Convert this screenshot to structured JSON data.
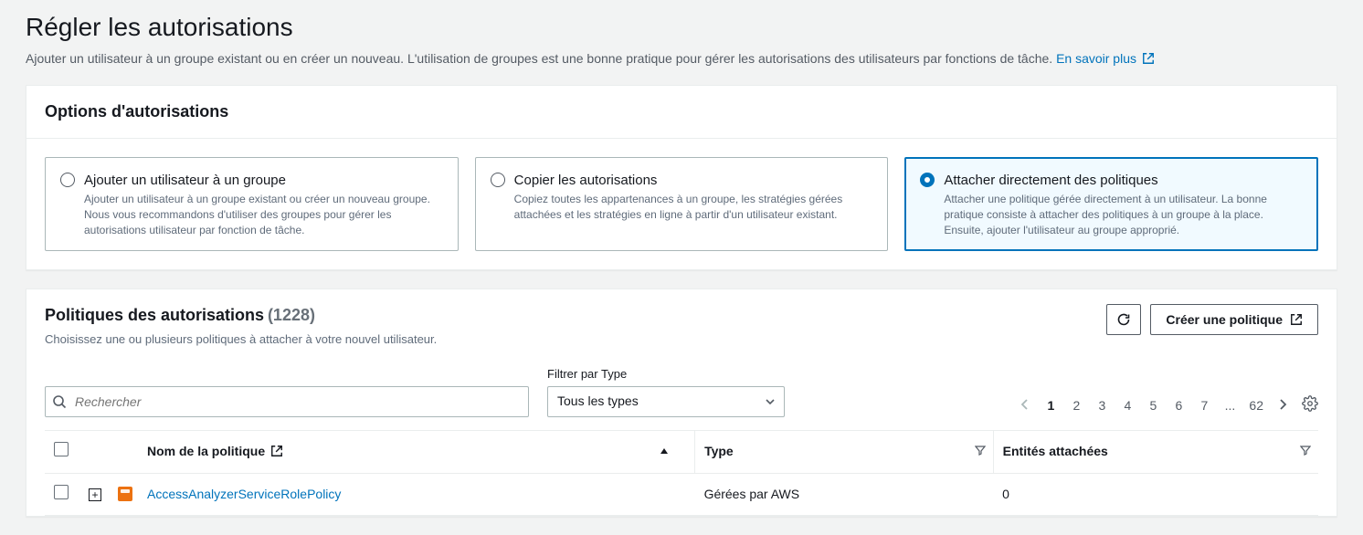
{
  "page": {
    "title": "Régler les autorisations",
    "subtitle_prefix": "Ajouter un utilisateur à un groupe existant ou en créer un nouveau. L'utilisation de groupes est une bonne pratique pour gérer les autorisations des utilisateurs par fonctions de tâche. ",
    "learn_more": "En savoir plus"
  },
  "options": {
    "panel_title": "Options d'autorisations",
    "items": [
      {
        "title": "Ajouter un utilisateur à un groupe",
        "desc": "Ajouter un utilisateur à un groupe existant ou créer un nouveau groupe. Nous vous recommandons d'utiliser des groupes pour gérer les autorisations utilisateur par fonction de tâche.",
        "selected": false
      },
      {
        "title": "Copier les autorisations",
        "desc": "Copiez toutes les appartenances à un groupe, les stratégies gérées attachées et les stratégies en ligne à partir d'un utilisateur existant.",
        "selected": false
      },
      {
        "title": "Attacher directement des politiques",
        "desc": "Attacher une politique gérée directement à un utilisateur. La bonne pratique consiste à attacher des politiques à un groupe à la place. Ensuite, ajouter l'utilisateur au groupe approprié.",
        "selected": true
      }
    ]
  },
  "policies": {
    "section_title": "Politiques des autorisations",
    "count_display": "(1228)",
    "section_sub": "Choisissez une ou plusieurs politiques à attacher à votre nouvel utilisateur.",
    "create_button": "Créer une politique",
    "search_placeholder": "Rechercher",
    "filter_label": "Filtrer par Type",
    "filter_value": "Tous les types",
    "pagination": {
      "pages": [
        "1",
        "2",
        "3",
        "4",
        "5",
        "6",
        "7",
        "...",
        "62"
      ],
      "current": "1"
    },
    "columns": {
      "name": "Nom de la politique",
      "type": "Type",
      "attached": "Entités attachées"
    },
    "rows": [
      {
        "name": "AccessAnalyzerServiceRolePolicy",
        "type": "Gérées par AWS",
        "attached": "0"
      }
    ]
  }
}
